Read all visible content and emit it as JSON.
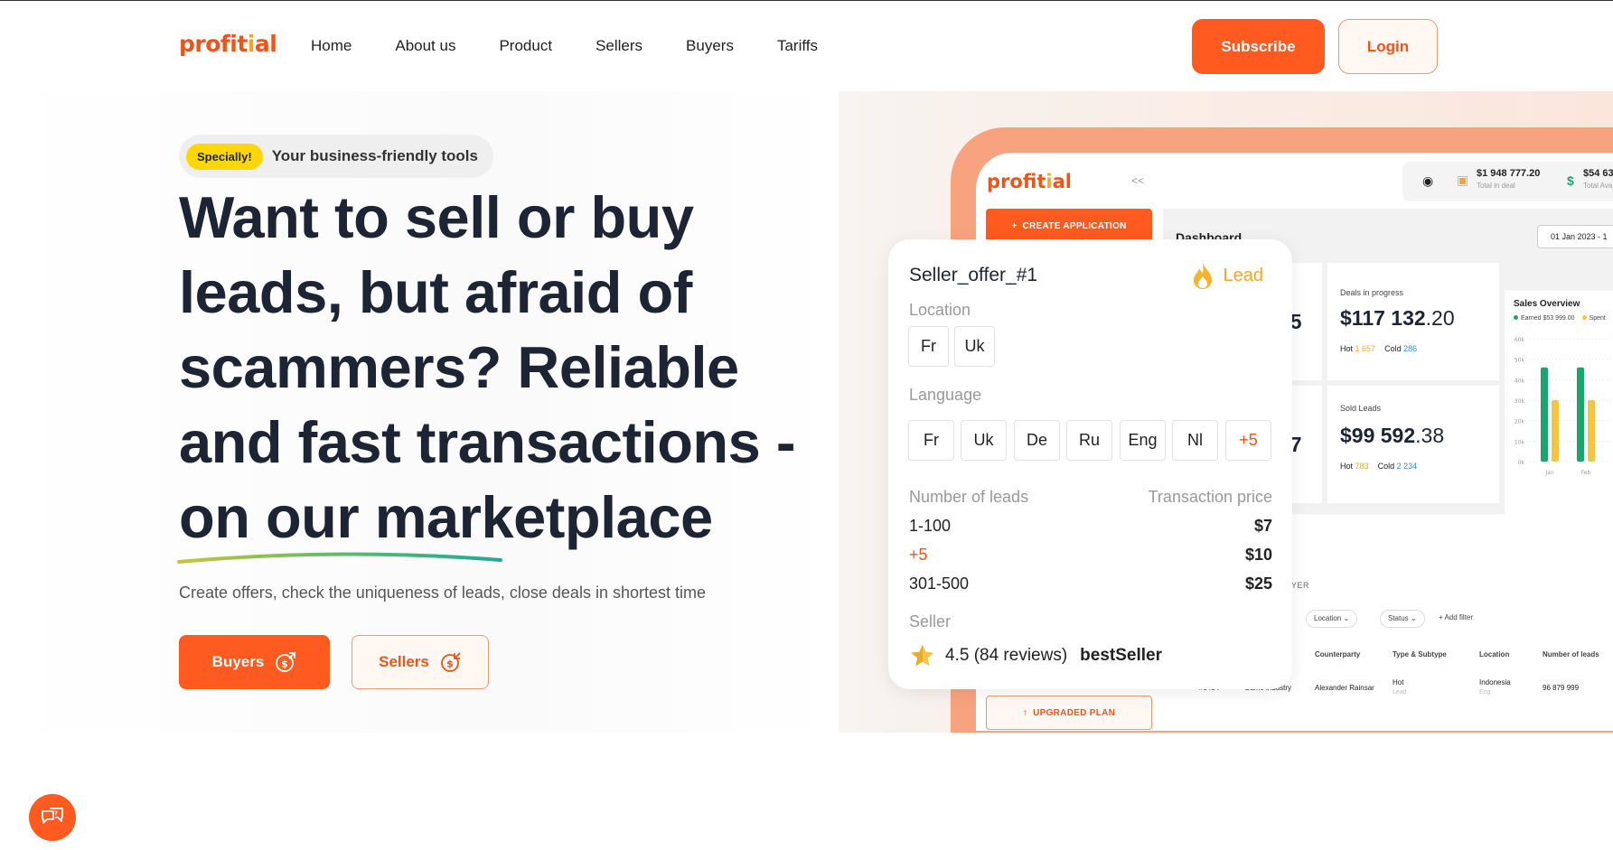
{
  "header": {
    "logo": "profital",
    "nav": [
      "Home",
      "About us",
      "Product",
      "Sellers",
      "Buyers",
      "Tariffs"
    ],
    "subscribe_label": "Subscribe",
    "login_label": "Login"
  },
  "hero": {
    "badge": "Specially!",
    "badge_text": "Your business-friendly tools",
    "headline": "Want to sell or buy leads, but afraid of scammers? Reliable and fast transactions - on our marketplace",
    "subtext": "Create offers, check the uniqueness of leads, close deals in shortest time",
    "buyers_label": "Buyers",
    "sellers_label": "Sellers"
  },
  "dashboard": {
    "logo": "profital",
    "collapse": "<<",
    "total_in_deal": "$1 948 777.20",
    "total_in_deal_label": "Total in deal",
    "total_available": "$54 63",
    "total_available_label": "Total Ava",
    "create_label": "CREATE APPLICATION",
    "title": "Dashboard",
    "date": "01 Jan 2023 - 1",
    "partial_value_1": "15",
    "partial_value_2": "47",
    "deals_label": "Deals in progress",
    "deals_value": "$117 132",
    "deals_cents": ".20",
    "deals_hot_label": "Hot",
    "deals_hot": "1 657",
    "deals_cold_label": "Cold",
    "deals_cold": "286",
    "sold_label": "Sold Leads",
    "sold_value": "$99 592",
    "sold_cents": ".38",
    "sold_hot_label": "Hot",
    "sold_hot": "783",
    "sold_cold_label": "Cold",
    "sold_cold": "2 234",
    "chart_title": "Sales Overview",
    "legend_earned": "Earned $53 999.00",
    "legend_spent": "Spent",
    "table_label": "UYER",
    "filters": [
      "Location",
      "Status"
    ],
    "add_filter": "+ Add filter",
    "columns": [
      "Counterparty",
      "Type & Subtype",
      "Location",
      "Number of leads"
    ],
    "row": {
      "id": "#5434",
      "industry": "Game industry",
      "counterparty": "Alexander Rainsar",
      "type": "Hot",
      "subtype": "Lead",
      "location": "Indonesia",
      "location_sub": "Eng",
      "leads": "96 879 999"
    },
    "upgrade_label": "UPGRADED PLAN"
  },
  "chart_data": {
    "type": "bar",
    "title": "Sales Overview",
    "yticks": [
      "60k",
      "50k",
      "40k",
      "30k",
      "20k",
      "10k",
      "0k"
    ],
    "categories": [
      "Jan",
      "Feb"
    ],
    "series": [
      {
        "name": "Earned $53 999.00",
        "values": [
          46,
          46
        ],
        "color": "#1ea370"
      },
      {
        "name": "Spent",
        "values": [
          30,
          30
        ],
        "color": "#f4c542"
      }
    ],
    "ylim": [
      0,
      60
    ]
  },
  "offer": {
    "title": "Seller_offer_#1",
    "lead": "Lead",
    "location_label": "Location",
    "locations": [
      "Fr",
      "Uk"
    ],
    "language_label": "Language",
    "languages": [
      "Fr",
      "Uk",
      "De",
      "Ru",
      "Eng",
      "Nl"
    ],
    "languages_more": "+5",
    "leads_label": "Number of leads",
    "price_label": "Transaction price",
    "rows": [
      {
        "range": "1-100",
        "price": "$7"
      },
      {
        "range": "+5",
        "price": "$10"
      },
      {
        "range": "301-500",
        "price": "$25"
      }
    ],
    "seller_label": "Seller",
    "rating": "4.5 (84 reviews)",
    "seller_name": "bestSeller"
  },
  "colors": {
    "accent": "#ff5a1f",
    "text": "#1d2433",
    "highlight": "#ffd60a",
    "hot": "#f4a62a",
    "cold": "#2b8fd8",
    "green": "#1ea370"
  }
}
